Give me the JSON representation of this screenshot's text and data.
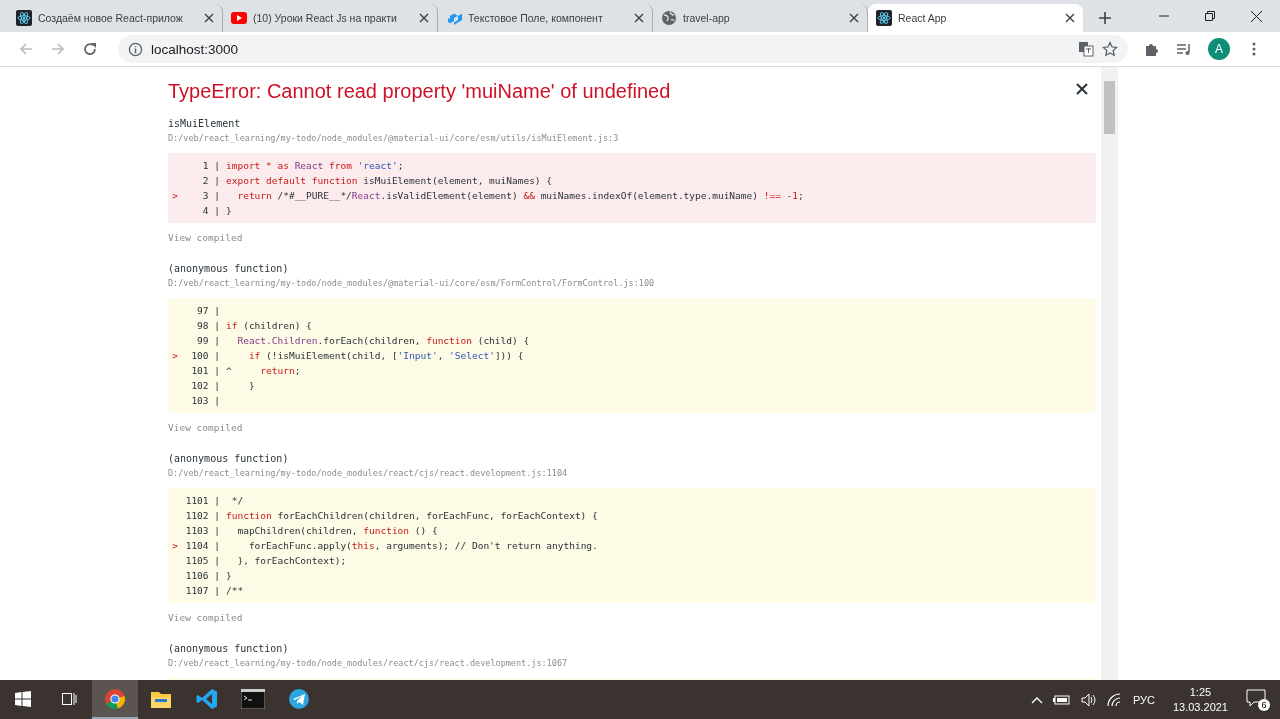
{
  "browser": {
    "tabs": [
      {
        "title": "Создаём новое React-прилож",
        "kind": "react",
        "selected": false
      },
      {
        "title": "(10) Уроки React Js на практи",
        "kind": "video",
        "selected": false
      },
      {
        "title": "Текстовое Поле, компонент",
        "kind": "mui",
        "selected": false
      },
      {
        "title": "travel-app",
        "kind": "globe",
        "selected": false
      },
      {
        "title": "React App",
        "kind": "react",
        "selected": true
      }
    ],
    "address": "localhost:3000",
    "avatar": "A"
  },
  "error": {
    "title": "TypeError: Cannot read property 'muiName' of undefined",
    "frames": [
      {
        "function": "isMuiElement",
        "file": "D:/veb/react_learning/my-todo/node_modules/@material-ui/core/esm/utils/isMuiElement.js:3",
        "kind": "error",
        "link": "View compiled",
        "lines": [
          {
            "gutter": "1 |",
            "tokens": [
              {
                "kind": "kw",
                "text": "import * as "
              },
              {
                "kind": "id",
                "text": "React"
              },
              {
                "kind": "kw",
                "text": " from "
              },
              {
                "kind": "str",
                "text": "'react'"
              },
              {
                "kind": "plain",
                "text": ";"
              }
            ]
          },
          {
            "gutter": "2 |",
            "tokens": [
              {
                "kind": "kw",
                "text": "export default function "
              },
              {
                "kind": "plain",
                "text": "isMuiElement(element, muiNames) {"
              }
            ]
          },
          {
            "gutter": "3 |",
            "arrow": ">",
            "tokens": [
              {
                "kind": "kw",
                "text": "  return "
              },
              {
                "kind": "plain",
                "text": "/*#__PURE__*/"
              },
              {
                "kind": "id",
                "text": "React"
              },
              {
                "kind": "plain",
                "text": ".isValidElement(element) "
              },
              {
                "kind": "kw",
                "text": "&&"
              },
              {
                "kind": "plain",
                "text": " muiNames.indexOf(element.type.muiName) "
              },
              {
                "kind": "kw",
                "text": "!== -1"
              },
              {
                "kind": "plain",
                "text": ";"
              }
            ]
          },
          {
            "gutter": "4 |",
            "tokens": [
              {
                "kind": "plain",
                "text": "}"
              }
            ]
          }
        ]
      },
      {
        "function": "(anonymous function)",
        "file": "D:/veb/react_learning/my-todo/node_modules/@material-ui/core/esm/FormControl/FormControl.js:100",
        "kind": "warn",
        "link": "View compiled",
        "lines": [
          {
            "gutter": "97 |"
          },
          {
            "gutter": "98 |",
            "tokens": [
              {
                "kind": "kw",
                "text": "if"
              },
              {
                "kind": "plain",
                "text": " (children) {"
              }
            ]
          },
          {
            "gutter": "99 |",
            "tokens": [
              {
                "kind": "id",
                "text": "  React.Children"
              },
              {
                "kind": "plain",
                "text": ".forEach(children, "
              },
              {
                "kind": "kw",
                "text": "function"
              },
              {
                "kind": "plain",
                "text": " (child) {"
              }
            ]
          },
          {
            "gutter": "100 |",
            "arrow": ">",
            "tokens": [
              {
                "kind": "kw",
                "text": "    if"
              },
              {
                "kind": "plain",
                "text": " (!isMuiElement(child, ["
              },
              {
                "kind": "str",
                "text": "'Input'"
              },
              {
                "kind": "plain",
                "text": ", "
              },
              {
                "kind": "str",
                "text": "'Select'"
              },
              {
                "kind": "plain",
                "text": "])) {"
              }
            ]
          },
          {
            "gutter": "101 |",
            "tokens": [
              {
                "kind": "plain",
                "text": "^     "
              },
              {
                "kind": "kw",
                "text": "return"
              },
              {
                "kind": "plain",
                "text": ";"
              }
            ]
          },
          {
            "gutter": "102 |",
            "tokens": [
              {
                "kind": "plain",
                "text": "    }"
              }
            ]
          },
          {
            "gutter": "103 |"
          }
        ]
      },
      {
        "function": "(anonymous function)",
        "file": "D:/veb/react_learning/my-todo/node_modules/react/cjs/react.development.js:1104",
        "kind": "warn",
        "link": "View compiled",
        "lines": [
          {
            "gutter": "1101 |",
            "tokens": [
              {
                "kind": "plain",
                "text": " */"
              }
            ]
          },
          {
            "gutter": "1102 |",
            "tokens": [
              {
                "kind": "kw",
                "text": "function"
              },
              {
                "kind": "plain",
                "text": " forEachChildren(children, forEachFunc, forEachContext) {"
              }
            ]
          },
          {
            "gutter": "1103 |",
            "tokens": [
              {
                "kind": "plain",
                "text": "  mapChildren(children, "
              },
              {
                "kind": "kw",
                "text": "function"
              },
              {
                "kind": "plain",
                "text": " () {"
              }
            ]
          },
          {
            "gutter": "1104 |",
            "arrow": ">",
            "tokens": [
              {
                "kind": "plain",
                "text": "    forEachFunc.apply("
              },
              {
                "kind": "kw",
                "text": "this"
              },
              {
                "kind": "plain",
                "text": ", arguments); // Don't return anything."
              }
            ]
          },
          {
            "gutter": "1105 |",
            "tokens": [
              {
                "kind": "plain",
                "text": "  }, forEachContext);"
              }
            ]
          },
          {
            "gutter": "1106 |",
            "tokens": [
              {
                "kind": "plain",
                "text": "}"
              }
            ]
          },
          {
            "gutter": "1107 |",
            "tokens": [
              {
                "kind": "plain",
                "text": "/**"
              }
            ]
          }
        ]
      },
      {
        "function": "(anonymous function)",
        "file": "D:/veb/react_learning/my-todo/node_modules/react/cjs/react.development.js:1067",
        "kind": "warn"
      }
    ]
  },
  "taskbar": {
    "apps": [
      {
        "kind": "chrome",
        "selected": true
      },
      {
        "kind": "explorer",
        "selected": false
      },
      {
        "kind": "vscode",
        "selected": false
      },
      {
        "kind": "terminal",
        "selected": false
      },
      {
        "kind": "telegram",
        "selected": false
      }
    ],
    "language": "РУС",
    "time": "1:25",
    "date": "13.03.2021",
    "notifications": "6"
  }
}
